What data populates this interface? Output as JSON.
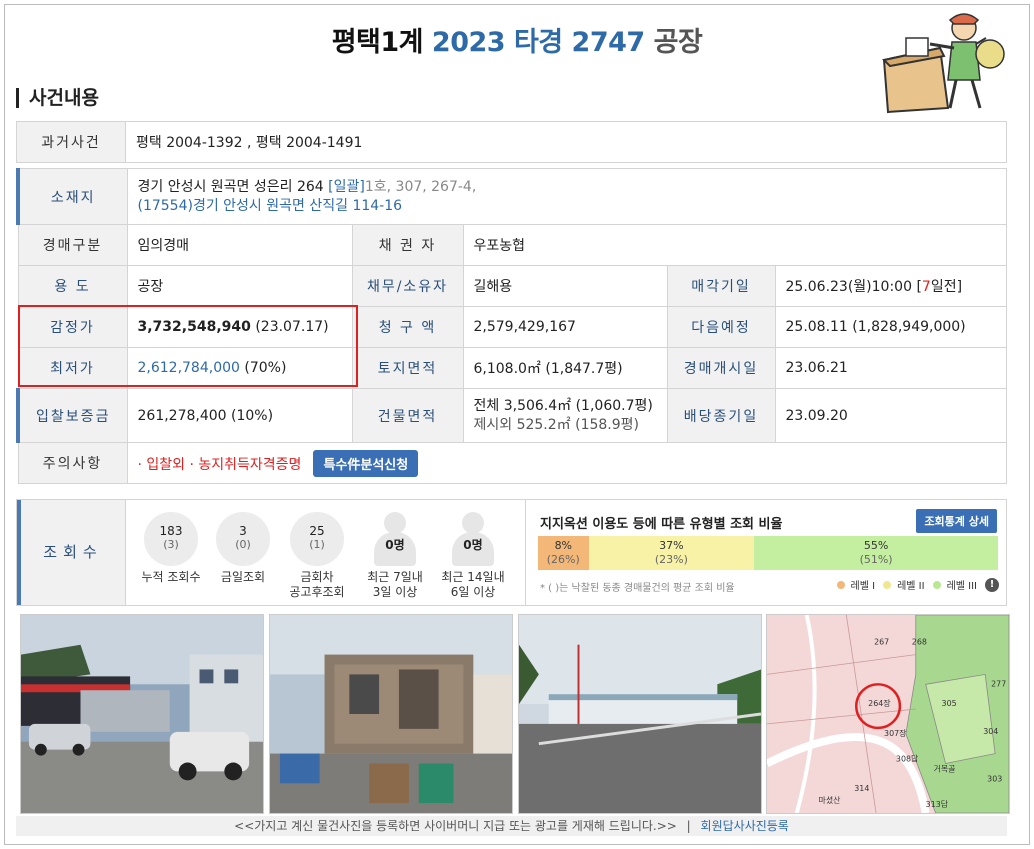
{
  "title": {
    "court": "평택1계",
    "case_no": "2023 타경 2747",
    "type": "공장"
  },
  "section": "사건내용",
  "past_case": {
    "label": "과거사건",
    "value": "평택 2004-1392   , 평택 2004-1491"
  },
  "address": {
    "label": "소재지",
    "line1": "경기 안성시 원곡면 성은리 264",
    "bulk": "[일괄]",
    "bulk_rest": "1호, 307, 267-4,",
    "line2": "(17554)경기 안성시  원곡면 산직길  114-16"
  },
  "rows": {
    "auction_type": {
      "label": "경매구분",
      "value": "임의경매"
    },
    "creditor": {
      "label": "채 권 자",
      "value": "우포농협"
    },
    "usage": {
      "label": "용 도",
      "value": "공장"
    },
    "debtor": {
      "label": "채무/소유자",
      "value": "길해용"
    },
    "sale_date": {
      "label": "매각기일",
      "value_pre": "25.06.23(월)10:00 [",
      "value_red": "7",
      "value_post": "일전]"
    },
    "appraisal": {
      "label": "감정가",
      "value": "3,732,548,940",
      "value_sub": "(23.07.17)"
    },
    "claim": {
      "label": "청 구 액",
      "value": "2,579,429,167"
    },
    "next": {
      "label": "다음예정",
      "value": "25.08.11 (1,828,949,000)"
    },
    "minimum": {
      "label": "최저가",
      "value": "2,612,784,000",
      "value_sub": "(70%)"
    },
    "land_area": {
      "label": "토지면적",
      "value": "6,108.0㎡ (1,847.7평)"
    },
    "start": {
      "label": "경매개시일",
      "value": "23.06.21"
    },
    "deposit": {
      "label": "입찰보증금",
      "value": "261,278,400 (10%)"
    },
    "building_area": {
      "label": "건물면적",
      "value1": "전체 3,506.4㎡ (1,060.7평)",
      "value2": "제시외 525.2㎡ (158.9평)"
    },
    "dividend": {
      "label": "배당종기일",
      "value": "23.09.20"
    },
    "caution": {
      "label": "주의사항",
      "value": "· 입찰외 · 농지취득자격증명",
      "button": "특수件분석신청"
    }
  },
  "views": {
    "label": "조회수",
    "stats": [
      {
        "n": "183",
        "s": "(3)",
        "cap1": "누적 조회수",
        "cap2": ""
      },
      {
        "n": "3",
        "s": "(0)",
        "cap1": "금일조회",
        "cap2": ""
      },
      {
        "n": "25",
        "s": "(1)",
        "cap1": "금회차",
        "cap2": "공고후조회"
      }
    ],
    "people": [
      {
        "n": "0명",
        "cap1": "최근 7일내",
        "cap2": "3일 이상"
      },
      {
        "n": "0명",
        "cap1": "최근 14일내",
        "cap2": "6일 이상"
      }
    ],
    "ratio_title": "지지옥션 이용도 등에 따른 유형별 조회 비율",
    "ratio_button": "조회통계 상세",
    "segments": [
      {
        "pct": "8%",
        "sub": "(26%)",
        "share": 11,
        "color": "#f3b777"
      },
      {
        "pct": "37%",
        "sub": "(23%)",
        "share": 36,
        "color": "#f7f2a6"
      },
      {
        "pct": "55%",
        "sub": "(51%)",
        "share": 53,
        "color": "#c4eea0"
      }
    ],
    "note": "* ( )는 낙찰된 동종 경매물건의 평균 조회 비율",
    "legend": [
      "레벨 I",
      "레벨 II",
      "레벨 III"
    ],
    "legend_colors": [
      "#f3b777",
      "#f7f2a6",
      "#c4eea0"
    ]
  },
  "map_labels": [
    "264장",
    "267",
    "268",
    "307장",
    "305",
    "304",
    "314",
    "308답",
    "313답",
    "303",
    "277",
    "거목골",
    "마셨산"
  ],
  "footer": {
    "text": "<<가지고 계신 물건사진을 등록하면 사이버머니 지급 또는 광고를 게재해 드립니다.>>",
    "sep": "|",
    "link": "회원답사사진등록"
  }
}
